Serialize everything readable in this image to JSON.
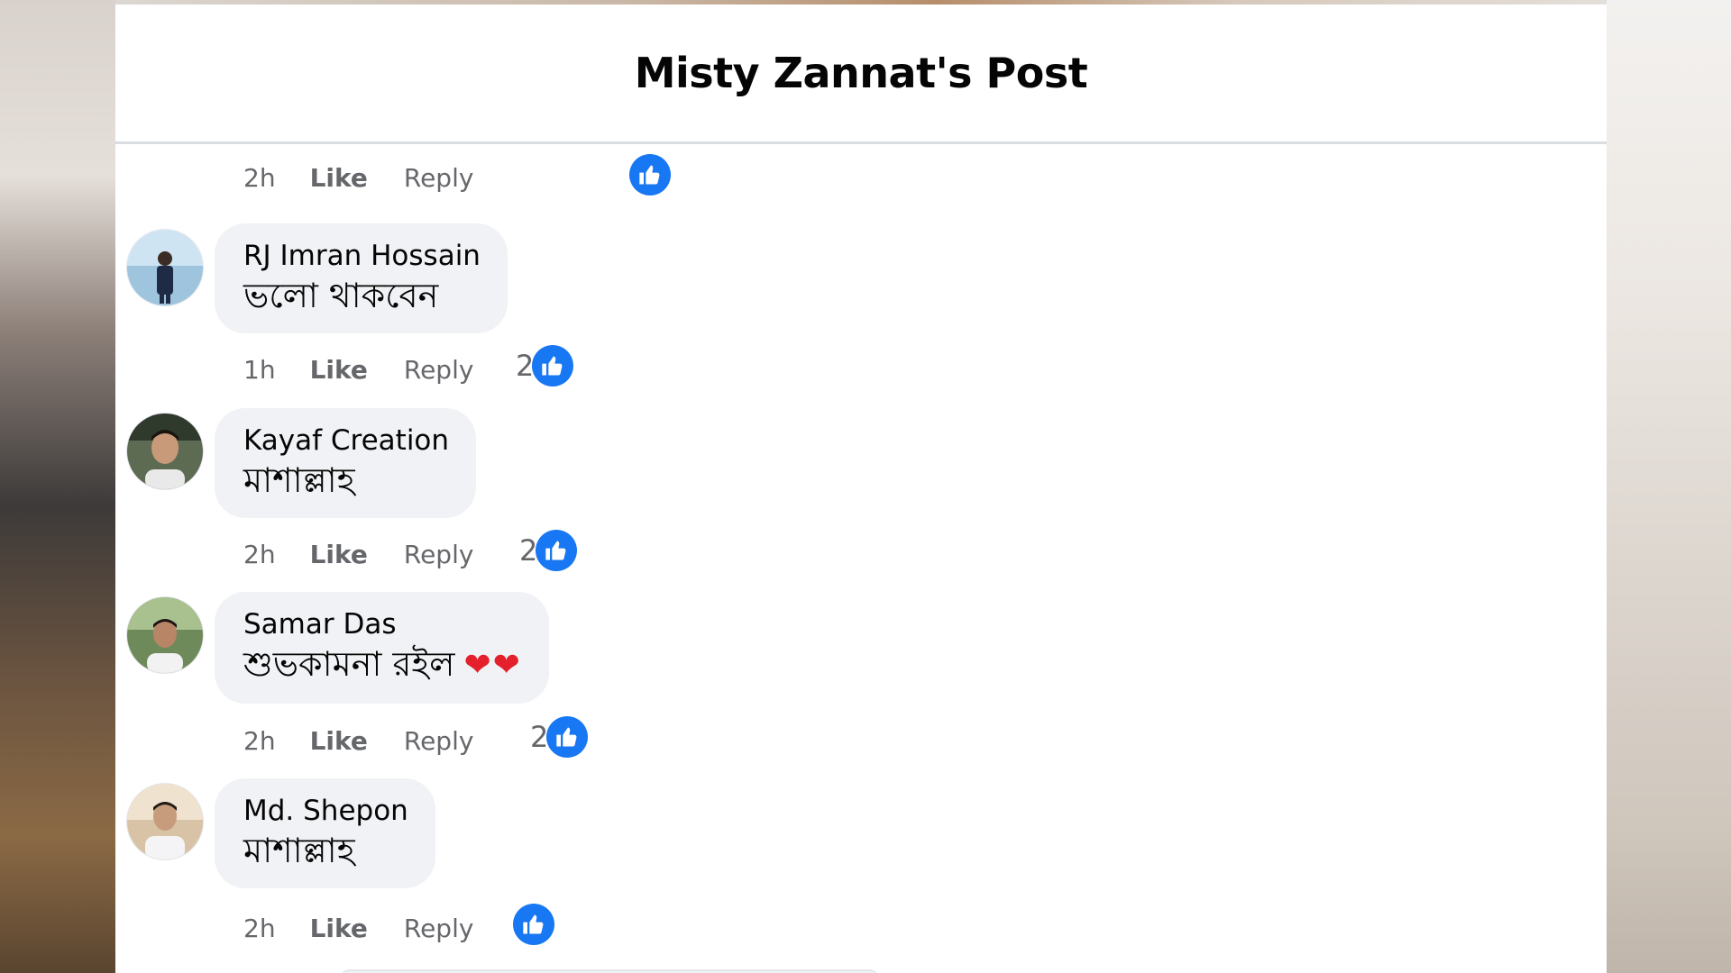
{
  "post": {
    "title": "Misty Zannat's Post"
  },
  "top_meta": {
    "time": "2h",
    "like": "Like",
    "reply": "Reply"
  },
  "comments": [
    {
      "author": "RJ Imran Hossain",
      "text": "ভলো থাকবেন",
      "time": "1h",
      "like": "Like",
      "reply": "Reply",
      "reactions": "2",
      "avatar_icon": "avatar-icon"
    },
    {
      "author": "Kayaf Creation",
      "text": "মাশাল্লাহ",
      "time": "2h",
      "like": "Like",
      "reply": "Reply",
      "reactions": "2",
      "avatar_icon": "avatar-icon"
    },
    {
      "author": "Samar Das",
      "text": "শুভকামনা রইল",
      "hearts": "❤❤",
      "time": "2h",
      "like": "Like",
      "reply": "Reply",
      "reactions": "2",
      "avatar_icon": "avatar-icon"
    },
    {
      "author": "Md. Shepon",
      "text": "মাশাল্লাহ",
      "time": "2h",
      "like": "Like",
      "reply": "Reply",
      "reactions": "",
      "avatar_icon": "avatar-icon"
    }
  ],
  "colors": {
    "accent": "#1877f2",
    "bubble": "#f0f2f5",
    "meta_text": "#65676b",
    "heart": "#e4202c"
  }
}
